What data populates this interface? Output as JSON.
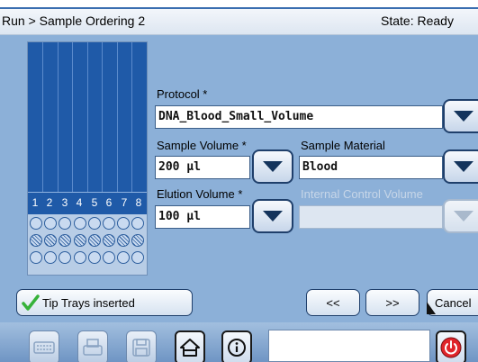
{
  "header": {
    "breadcrumb": "Run > Sample Ordering 2",
    "state": "State: Ready"
  },
  "rack": {
    "positions": [
      "1",
      "2",
      "3",
      "4",
      "5",
      "6",
      "7",
      "8"
    ],
    "well_rows": [
      "empty",
      "crossed",
      "empty"
    ]
  },
  "form": {
    "protocol_label": "Protocol *",
    "protocol_value": "DNA_Blood_Small_Volume",
    "sample_volume_label": "Sample Volume *",
    "sample_volume_value": "200 µl",
    "sample_material_label": "Sample Material",
    "sample_material_value": "Blood",
    "elution_volume_label": "Elution Volume *",
    "elution_volume_value": "100 µl",
    "internal_control_label": "Internal Control Volume",
    "internal_control_value": ""
  },
  "actions": {
    "tip_trays_label": "Tip Trays inserted",
    "prev_label": "<<",
    "next_label": ">>",
    "cancel_label": "Cancel"
  },
  "toolbar": {
    "icons": [
      "keyboard-icon",
      "printer-icon",
      "save-icon",
      "home-icon",
      "info-icon",
      "power-icon"
    ],
    "message_text": ""
  },
  "colors": {
    "panel_bg": "#8cb0d8",
    "rack_blue": "#1f5aa8",
    "check_green": "#36b23a",
    "stop_red": "#e0242a"
  }
}
